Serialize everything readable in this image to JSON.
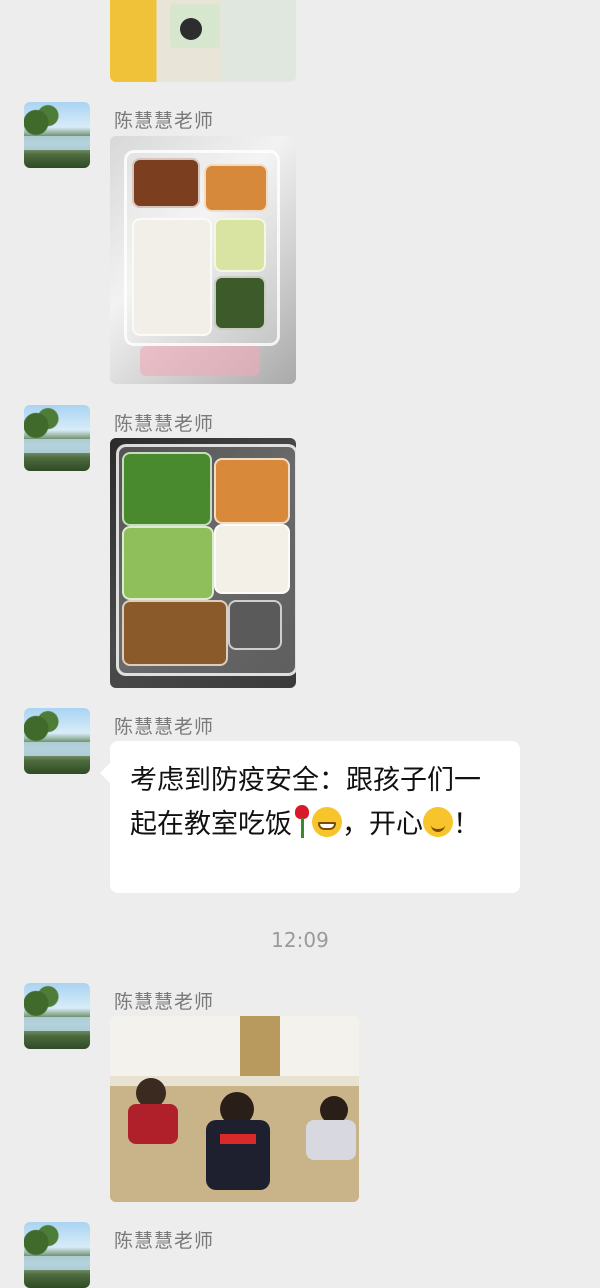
{
  "chat": {
    "messages": [
      {
        "sender": "",
        "type": "image",
        "image_desc": "food-photo"
      },
      {
        "sender": "陈慧慧老师",
        "type": "image",
        "image_desc": "lunch-tray-photo"
      },
      {
        "sender": "陈慧慧老师",
        "type": "image",
        "image_desc": "lunch-tray-photo"
      },
      {
        "sender": "陈慧慧老师",
        "type": "text",
        "text_part1": "考虑到防疫安全：跟孩子们一起在教室吃饭",
        "text_part2": "，开心",
        "text_part3": "！"
      },
      {
        "sender": "陈慧慧老师",
        "type": "image",
        "image_desc": "classroom-photo"
      },
      {
        "sender": "陈慧慧老师",
        "type": "partial"
      }
    ],
    "timestamp": "12:09"
  },
  "colors": {
    "background": "#ededed",
    "bubble": "#ffffff",
    "sender_text": "#7a7a7a"
  },
  "icons": [
    "avatar-lake-image",
    "rose-emoji",
    "grin-emoji",
    "smile-emoji"
  ]
}
